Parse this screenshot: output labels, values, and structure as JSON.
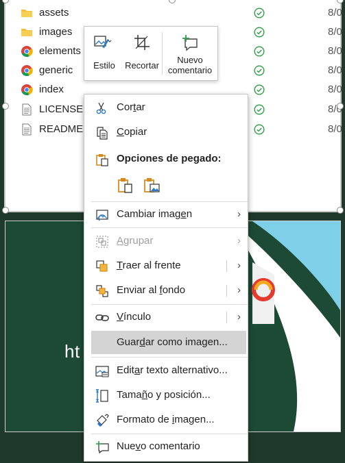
{
  "files": [
    {
      "name": "assets",
      "icon": "folder-icon",
      "date": "8/0"
    },
    {
      "name": "images",
      "icon": "folder-icon",
      "date": "8/0"
    },
    {
      "name": "elements",
      "icon": "chrome-icon",
      "date": "8/0"
    },
    {
      "name": "generic",
      "icon": "chrome-icon",
      "date": "8/0"
    },
    {
      "name": "index",
      "icon": "chrome-icon",
      "date": "8/0"
    },
    {
      "name": "LICENSE",
      "icon": "document-icon",
      "date": "8/0"
    },
    {
      "name": "README",
      "icon": "document-icon",
      "date": "8/0"
    }
  ],
  "background_text": "ht                              up-p...",
  "toolbar": {
    "style_label": "Estilo",
    "crop_label": "Recortar",
    "comment_label_1": "Nuevo",
    "comment_label_2": "comentario"
  },
  "menu": {
    "cut": {
      "pre": "Cor",
      "key": "t",
      "post": "ar"
    },
    "copy": {
      "pre": "",
      "key": "C",
      "post": "opiar"
    },
    "paste_options": "Opciones de pegado:",
    "change_image": {
      "pre": "Cambiar imag",
      "key": "e",
      "post": "n"
    },
    "group": {
      "pre": "",
      "key": "A",
      "post": "grupar"
    },
    "bring_front": {
      "pre": "",
      "key": "T",
      "post": "raer al frente"
    },
    "send_back": {
      "pre": "Enviar al ",
      "key": "f",
      "post": "ondo"
    },
    "link": {
      "pre": "",
      "key": "V",
      "post": "ínculo"
    },
    "save_as_image": {
      "pre": "Guar",
      "key": "d",
      "post": "ar como imagen..."
    },
    "alt_text": {
      "pre": "Edit",
      "key": "a",
      "post": "r texto alternativo..."
    },
    "size_position": {
      "pre": "Tama",
      "key": "ñ",
      "post": "o y posición..."
    },
    "format_image": {
      "pre": "Formato de ",
      "key": "i",
      "post": "magen..."
    },
    "new_comment": {
      "pre": "Nue",
      "key": "v",
      "post": "o comentario"
    }
  },
  "colors": {
    "accent": "#2b78c5",
    "paste_orange": "#d68a1c",
    "check_green": "#2e9e44",
    "menu_hover": "#d4d4d4"
  }
}
